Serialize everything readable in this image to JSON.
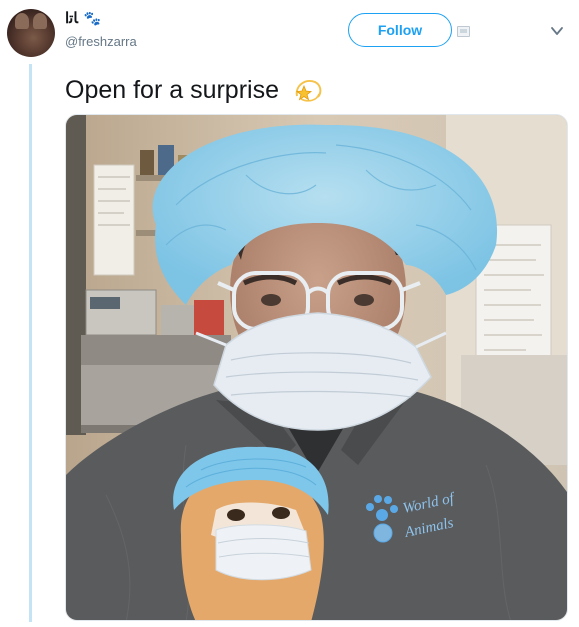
{
  "user": {
    "display_name": "ﺎﺗﺍ",
    "name_emoji": "🐾",
    "handle": "@freshzarra",
    "avatar_icon": "profile-avatar"
  },
  "actions": {
    "follow_label": "Follow"
  },
  "tweet": {
    "text": "Open for a surprise",
    "emoji_icon": "dizzy-star-icon"
  },
  "photo": {
    "jacket_logo_line1": "World of",
    "jacket_logo_line2": "Animals"
  },
  "colors": {
    "accent": "#1da1f2",
    "thread_line": "#c4e3f5",
    "text": "#14171a",
    "muted": "#657786"
  }
}
